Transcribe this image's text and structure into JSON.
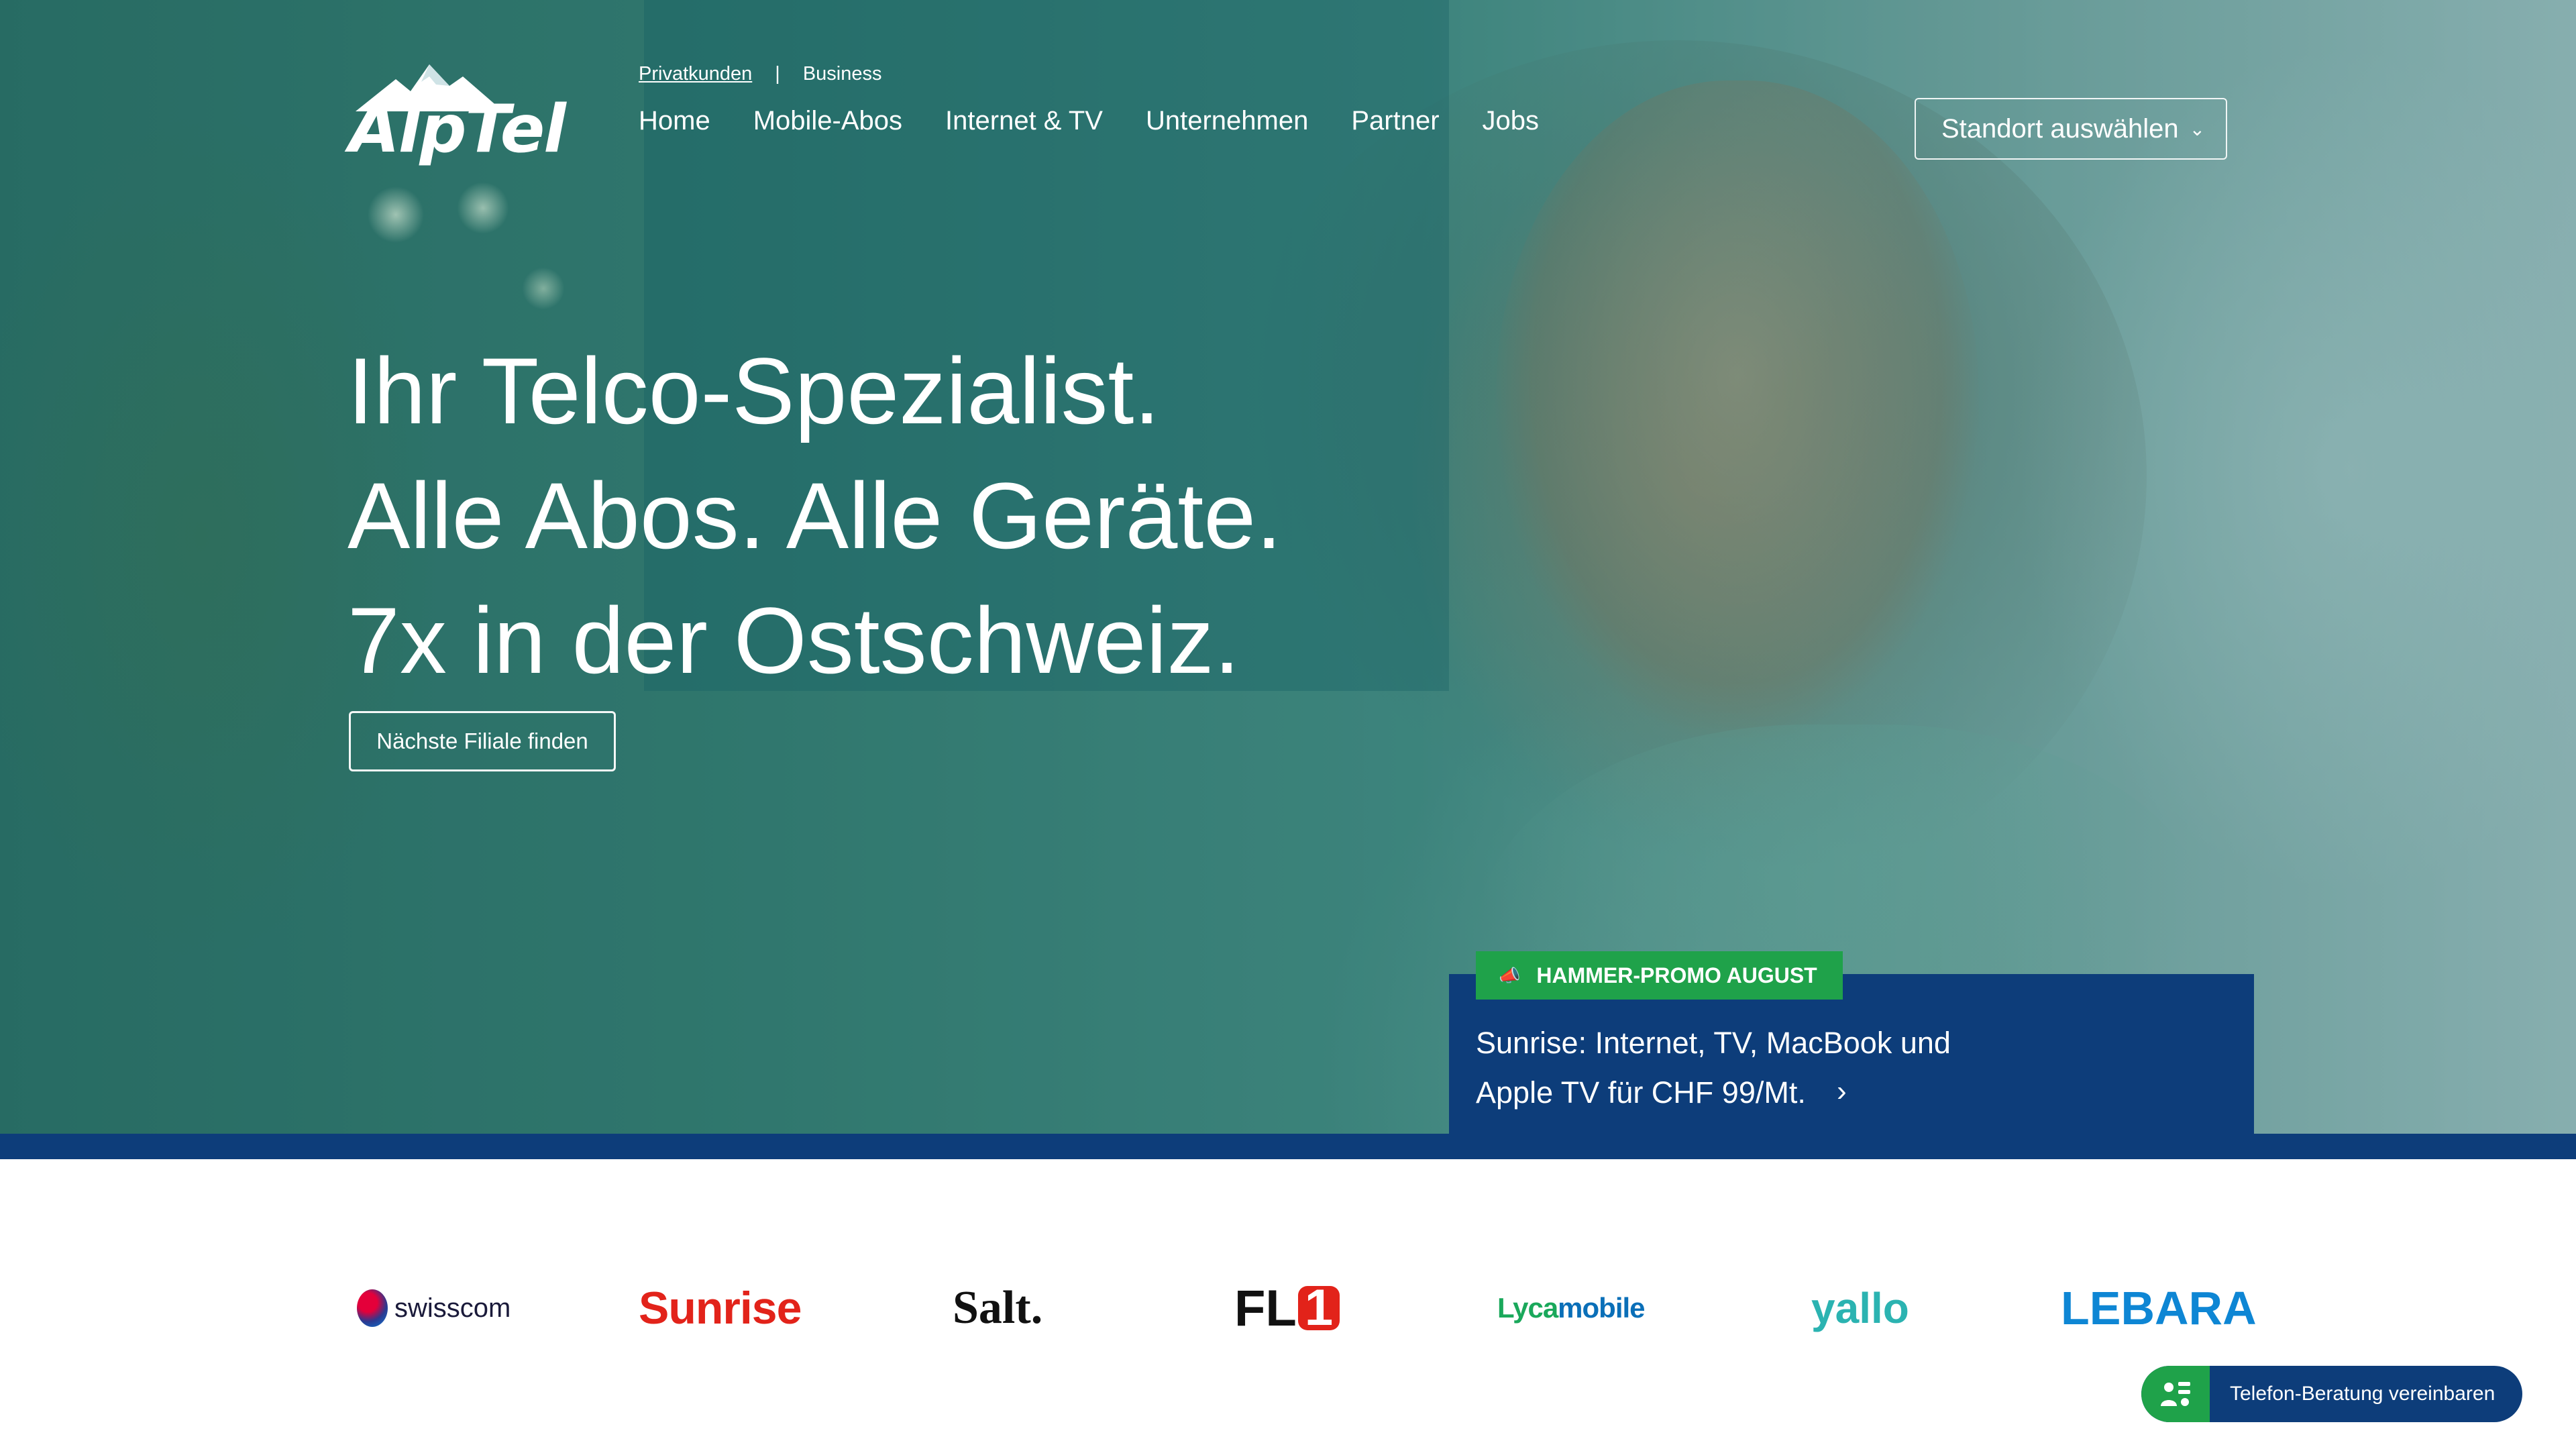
{
  "brand": {
    "logo_text": "AlpTel"
  },
  "top_links": {
    "privat": "Privatkunden",
    "separator": "|",
    "business": "Business"
  },
  "nav": [
    "Home",
    "Mobile-Abos",
    "Internet & TV",
    "Unternehmen",
    "Partner",
    "Jobs"
  ],
  "standort": {
    "label": "Standort auswählen",
    "chevron": "⌄"
  },
  "hero": {
    "line1": "Ihr Telco-Spezialist.",
    "line2": "Alle Abos. Alle Geräte.",
    "line3": "7x in der Ostschweiz.",
    "button": "Nächste Filiale finden"
  },
  "promo": {
    "badge": "HAMMER-PROMO AUGUST",
    "line1": "Sunrise: Internet, TV, MacBook und",
    "line2": "Apple TV für CHF 99/Mt.",
    "arrow": "›"
  },
  "partners": {
    "swisscom": "swisscom",
    "sunrise": "Sunrise",
    "salt": "Salt.",
    "fl1_text": "FL",
    "fl1_num": "1",
    "lyca_a": "Lyca",
    "lyca_b": "mobile",
    "yallo": "yallo",
    "lebara": "LEBARA"
  },
  "callback": {
    "label": "Telefon-Beratung vereinbaren"
  },
  "colors": {
    "navy": "#0d3d7a",
    "green": "#1fa24a",
    "sunrise_red": "#e2231a",
    "lebara_blue": "#0e86d4",
    "yallo_teal": "#2bb3b1"
  }
}
